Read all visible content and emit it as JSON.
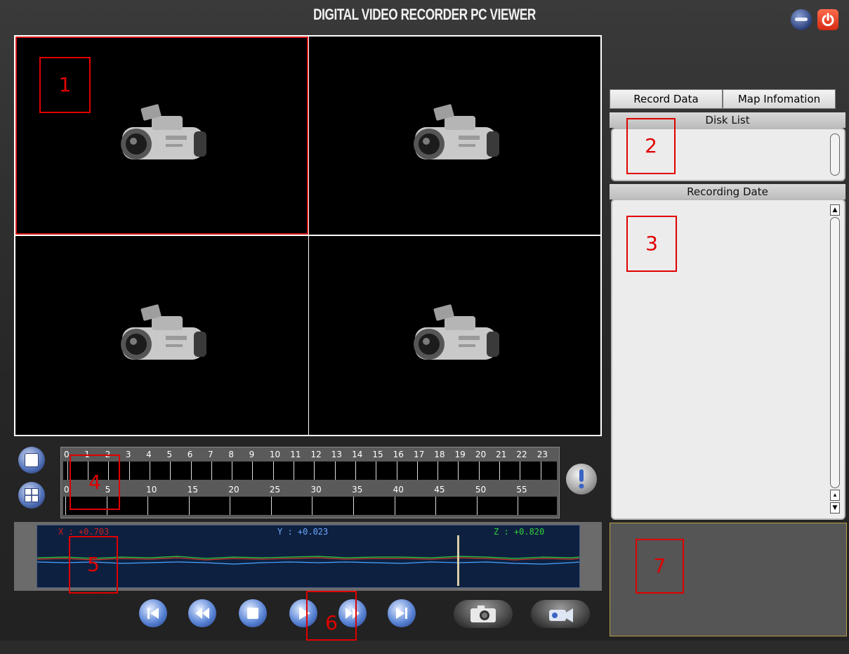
{
  "window": {
    "title": "DIGITAL VIDEO RECORDER PC VIEWER"
  },
  "tabs": [
    "Record Data",
    "Map Infomation"
  ],
  "sections": {
    "disk_list": "Disk List",
    "recording_date": "Recording Date"
  },
  "timeline": {
    "hours": [
      "0",
      "1",
      "2",
      "3",
      "4",
      "5",
      "6",
      "7",
      "8",
      "9",
      "10",
      "11",
      "12",
      "13",
      "14",
      "15",
      "16",
      "17",
      "18",
      "19",
      "20",
      "21",
      "22",
      "23"
    ],
    "minutes": [
      "0",
      "5",
      "10",
      "15",
      "20",
      "25",
      "30",
      "35",
      "40",
      "45",
      "50",
      "55"
    ]
  },
  "graph": {
    "x_label": "X : +0.703",
    "y_label": "Y : +0.023",
    "z_label": "Z : +0.820"
  },
  "markers": [
    "1",
    "2",
    "3",
    "4",
    "5",
    "6",
    "7"
  ],
  "colors": {
    "selected_border": "#d71a1a",
    "marker": "#e00000",
    "graph_bg": "#0e2040"
  }
}
